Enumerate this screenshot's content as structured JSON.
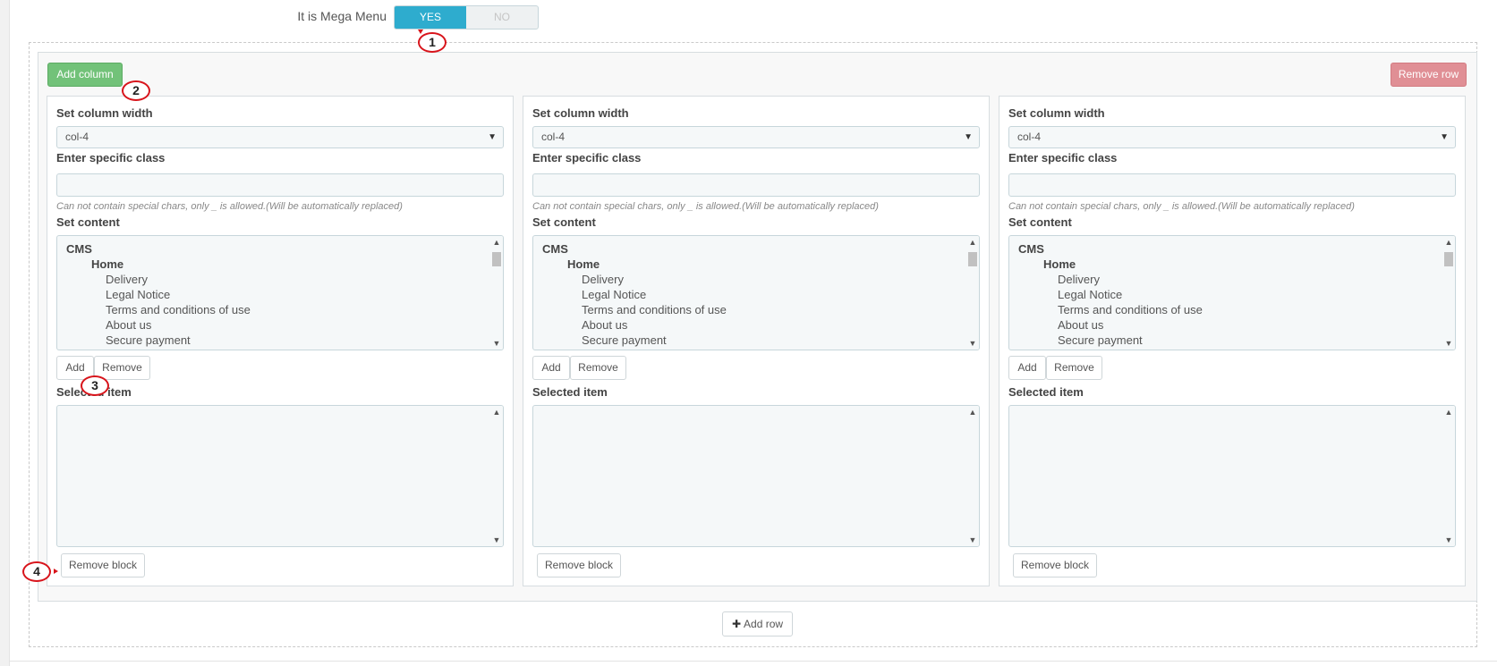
{
  "mega_menu": {
    "label": "It is Mega Menu",
    "yes": "YES",
    "no": "NO",
    "selected": "YES"
  },
  "row_actions": {
    "add_column": "Add column",
    "remove_row": "Remove row",
    "add_row": "Add row"
  },
  "columns": [
    {
      "width_label": "Set column width",
      "width_value": "col-4",
      "class_label": "Enter specific class",
      "class_value": "",
      "hint": "Can not contain special chars, only _ is allowed.(Will be automatically replaced)",
      "content_label": "Set content",
      "content_items": [
        "CMS",
        "Home",
        "Delivery",
        "Legal Notice",
        "Terms and conditions of use",
        "About us",
        "Secure payment"
      ],
      "add_label": "Add",
      "remove_label": "Remove",
      "selected_label": "Selected item",
      "remove_block_label": "Remove block"
    },
    {
      "width_label": "Set column width",
      "width_value": "col-4",
      "class_label": "Enter specific class",
      "class_value": "",
      "hint": "Can not contain special chars, only _ is allowed.(Will be automatically replaced)",
      "content_label": "Set content",
      "content_items": [
        "CMS",
        "Home",
        "Delivery",
        "Legal Notice",
        "Terms and conditions of use",
        "About us",
        "Secure payment"
      ],
      "add_label": "Add",
      "remove_label": "Remove",
      "selected_label": "Selected item",
      "remove_block_label": "Remove block"
    },
    {
      "width_label": "Set column width",
      "width_value": "col-4",
      "class_label": "Enter specific class",
      "class_value": "",
      "hint": "Can not contain special chars, only _ is allowed.(Will be automatically replaced)",
      "content_label": "Set content",
      "content_items": [
        "CMS",
        "Home",
        "Delivery",
        "Legal Notice",
        "Terms and conditions of use",
        "About us",
        "Secure payment"
      ],
      "add_label": "Add",
      "remove_label": "Remove",
      "selected_label": "Selected item",
      "remove_block_label": "Remove block"
    }
  ],
  "annotations": [
    "1",
    "2",
    "3",
    "4"
  ],
  "icons": {
    "dropdown": "caret-down-icon",
    "add_row": "plus-icon",
    "scroll_up": "scroll-up-icon",
    "scroll_down": "scroll-down-icon"
  },
  "colors": {
    "toggle_yes": "#2eacce",
    "add_column": "#72c279",
    "remove_row": "#e08f95",
    "annotation": "#d8141b"
  }
}
